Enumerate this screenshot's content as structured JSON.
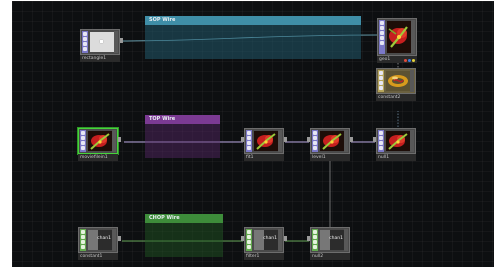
{
  "annotations": {
    "sop_wire": "SOP Wire",
    "top_wire": "TOP Wire",
    "chop_wire": "CHOP Wire"
  },
  "nodes": {
    "rectangle1": {
      "label": "rectangle1",
      "kind": "SOP"
    },
    "geo1": {
      "label": "geo1",
      "kind": "COMP"
    },
    "constant2": {
      "label": "constant2",
      "kind": "MAT"
    },
    "moviefilein1": {
      "label": "moviefilein1",
      "kind": "TOP"
    },
    "fit1": {
      "label": "fit1",
      "kind": "TOP"
    },
    "level1": {
      "label": "level1",
      "kind": "TOP"
    },
    "null1": {
      "label": "null1",
      "kind": "TOP"
    },
    "constant1": {
      "label": "constant1",
      "kind": "CHOP",
      "thumb_text": "chan1"
    },
    "filter1": {
      "label": "filter1",
      "kind": "CHOP",
      "thumb_text": "chan1"
    },
    "null2": {
      "label": "null2",
      "kind": "CHOP",
      "thumb_text": "chan1"
    }
  },
  "colors": {
    "background": "#0d0f11",
    "sop_header": "#3f8ea7",
    "top_header": "#7b3a93",
    "chop_header": "#3d8c3a",
    "wire": "#7ec3d6",
    "chop_wire": "#7ed06a",
    "selected_border": "#47d33c"
  }
}
